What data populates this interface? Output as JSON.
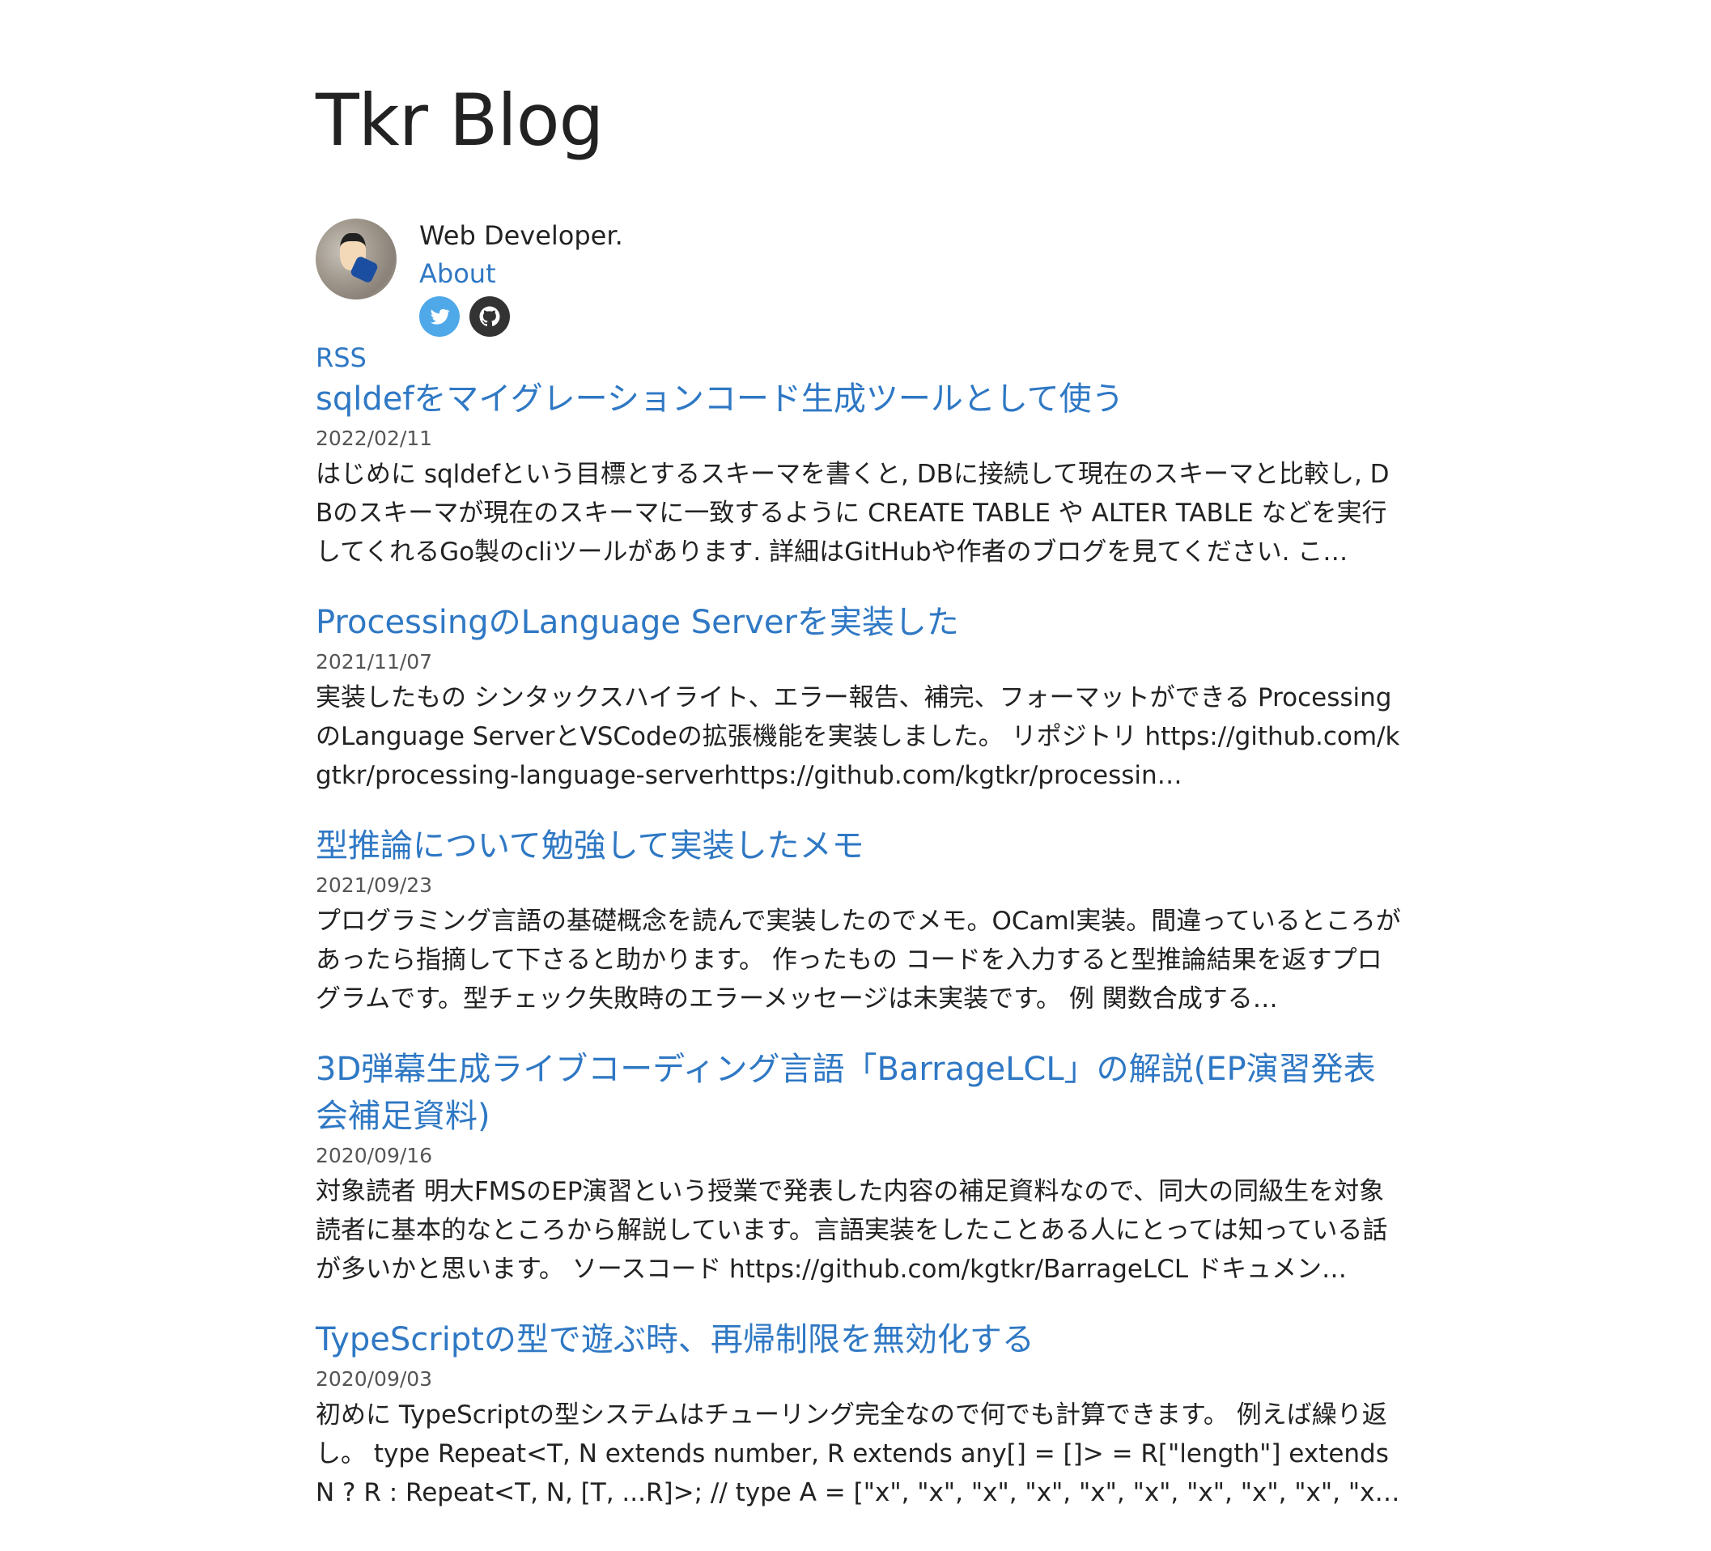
{
  "site": {
    "title": "Tkr Blog"
  },
  "profile": {
    "bio": "Web Developer.",
    "about_label": "About",
    "social": [
      {
        "icon": "twitter-icon",
        "color": "#4fa8e8"
      },
      {
        "icon": "github-icon",
        "color": "#333333"
      }
    ]
  },
  "rss_label": "RSS",
  "colors": {
    "link": "#2f78c4",
    "text": "#222222",
    "date": "#555555"
  },
  "posts": [
    {
      "title": "sqldefをマイグレーションコード生成ツールとして使う",
      "date": "2022/02/11",
      "excerpt": "はじめに sqldefという目標とするスキーマを書くと, DBに接続して現在のスキーマと比較し, DBのスキーマが現在のスキーマに一致するように CREATE TABLE や ALTER TABLE などを実行してくれるGo製のcliツールがあります. 詳細はGitHubや作者のブログを見てください. こ…"
    },
    {
      "title": "ProcessingのLanguage Serverを実装した",
      "date": "2021/11/07",
      "excerpt": "実装したもの シンタックスハイライト、エラー報告、補完、フォーマットができる ProcessingのLanguage ServerとVSCodeの拡張機能を実装しました。 リポジトリ https://github.com/kgtkr/processing-language-serverhttps://github.com/kgtkr/processin…"
    },
    {
      "title": "型推論について勉強して実装したメモ",
      "date": "2021/09/23",
      "excerpt": "プログラミング言語の基礎概念を読んで実装したのでメモ。OCaml実装。間違っているところがあったら指摘して下さると助かります。 作ったもの コードを入力すると型推論結果を返すプログラムです。型チェック失敗時のエラーメッセージは未実装です。 例 関数合成する…"
    },
    {
      "title": "3D弾幕生成ライブコーディング言語「BarrageLCL」の解説(EP演習発表会補足資料)",
      "date": "2020/09/16",
      "excerpt": "対象読者 明大FMSのEP演習という授業で発表した内容の補足資料なので、同大の同級生を対象読者に基本的なところから解説しています。言語実装をしたことある人にとっては知っている話が多いかと思います。 ソースコード https://github.com/kgtkr/BarrageLCL ドキュメン…"
    },
    {
      "title": "TypeScriptの型で遊ぶ時、再帰制限を無効化する",
      "date": "2020/09/03",
      "excerpt": "初めに TypeScriptの型システムはチューリング完全なので何でも計算できます。 例えば繰り返し。 type Repeat<T, N extends number, R extends any[] = []> = R[\"length\"] extends N ? R : Repeat<T, N, [T, ...R]>; // type A = [\"x\", \"x\", \"x\", \"x\", \"x\", \"x\", \"x\", \"x\", \"x\", \"x\"] type A =…"
    }
  ]
}
